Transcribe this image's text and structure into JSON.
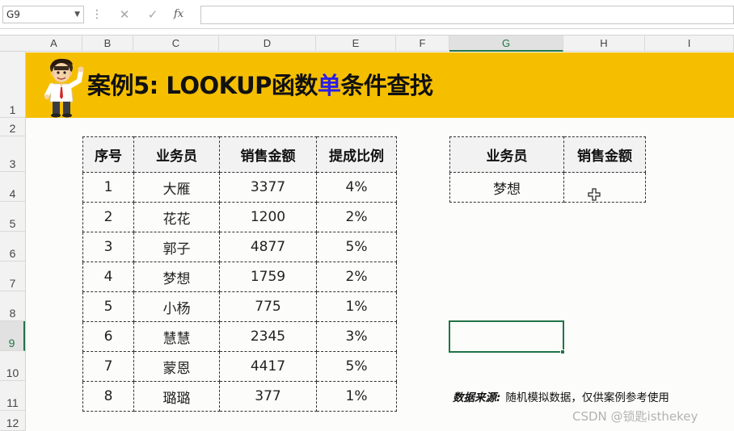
{
  "formula_bar": {
    "name_box": "G9",
    "separator_icon": "vertical-ellipsis",
    "cancel_icon": "✕",
    "enter_icon": "✓",
    "fx_label": "fx",
    "formula": ""
  },
  "columns": [
    "A",
    "B",
    "C",
    "D",
    "E",
    "F",
    "G",
    "H",
    "I"
  ],
  "selected_column": "G",
  "rows": [
    "1",
    "2",
    "3",
    "4",
    "5",
    "6",
    "7",
    "8",
    "9",
    "10",
    "11",
    "12"
  ],
  "selected_row": "9",
  "banner": {
    "title_prefix": "案例5: LOOKUP函数",
    "title_highlight": "单",
    "title_suffix": "条件查找",
    "background": "#f5bf00",
    "highlight_color": "#2c1ee6"
  },
  "main_table": {
    "headers": [
      "序号",
      "业务员",
      "销售金额",
      "提成比例"
    ],
    "rows": [
      [
        "1",
        "大雁",
        "3377",
        "4%"
      ],
      [
        "2",
        "花花",
        "1200",
        "2%"
      ],
      [
        "3",
        "郭子",
        "4877",
        "5%"
      ],
      [
        "4",
        "梦想",
        "1759",
        "2%"
      ],
      [
        "5",
        "小杨",
        "775",
        "1%"
      ],
      [
        "6",
        "慧慧",
        "2345",
        "3%"
      ],
      [
        "7",
        "蒙恩",
        "4417",
        "5%"
      ],
      [
        "8",
        "璐璐",
        "377",
        "1%"
      ]
    ]
  },
  "lookup_table": {
    "headers": [
      "业务员",
      "销售金额"
    ],
    "row": [
      "梦想",
      ""
    ]
  },
  "note": {
    "label": "数据来源:",
    "text": "随机模拟数据，仅供案例参考使用"
  },
  "watermark": "CSDN @锁匙isthekey",
  "accent_color": "#217346"
}
